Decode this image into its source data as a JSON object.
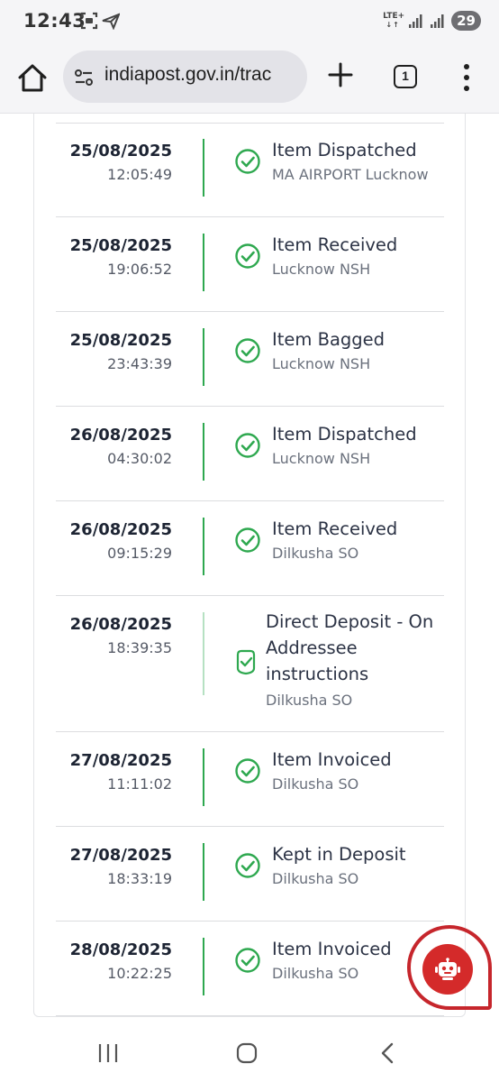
{
  "status_bar": {
    "time": "12:43",
    "network": "LTE+",
    "battery": "29"
  },
  "browser": {
    "url": "indiapost.gov.in/trac",
    "tab_count": "1"
  },
  "tracking_events": [
    {
      "date": "25/08/2025",
      "time": "12:05:49",
      "event": "Item Dispatched",
      "office": "MA AIRPORT Lucknow"
    },
    {
      "date": "25/08/2025",
      "time": "19:06:52",
      "event": "Item Received",
      "office": "Lucknow NSH"
    },
    {
      "date": "25/08/2025",
      "time": "23:43:39",
      "event": "Item Bagged",
      "office": "Lucknow NSH"
    },
    {
      "date": "26/08/2025",
      "time": "04:30:02",
      "event": "Item Dispatched",
      "office": "Lucknow NSH"
    },
    {
      "date": "26/08/2025",
      "time": "09:15:29",
      "event": "Item Received",
      "office": "Dilkusha SO"
    },
    {
      "date": "26/08/2025",
      "time": "18:39:35",
      "event_lines": [
        "Direct Deposit - On",
        "Addressee",
        "instructions"
      ],
      "office": "Dilkusha SO"
    },
    {
      "date": "27/08/2025",
      "time": "11:11:02",
      "event": "Item Invoiced",
      "office": "Dilkusha SO"
    },
    {
      "date": "27/08/2025",
      "time": "18:33:19",
      "event": "Kept in Deposit",
      "office": "Dilkusha SO"
    },
    {
      "date": "28/08/2025",
      "time": "10:22:25",
      "event": "Item Invoiced",
      "office": "Dilkusha SO"
    }
  ],
  "colors": {
    "timeline_green": "#2ea84f",
    "chatbot_red": "#d42a2a"
  },
  "icons": {
    "status": [
      "screenshot-icon",
      "send-icon",
      "signal-icon",
      "battery-icon"
    ],
    "browser": [
      "home-icon",
      "site-settings-icon",
      "new-tab-icon",
      "tab-switcher-icon",
      "more-menu-icon"
    ],
    "timeline": "check-circle-icon",
    "chatbot": "chatbot-icon",
    "nav": [
      "recents-icon",
      "home-nav-icon",
      "back-icon"
    ]
  }
}
